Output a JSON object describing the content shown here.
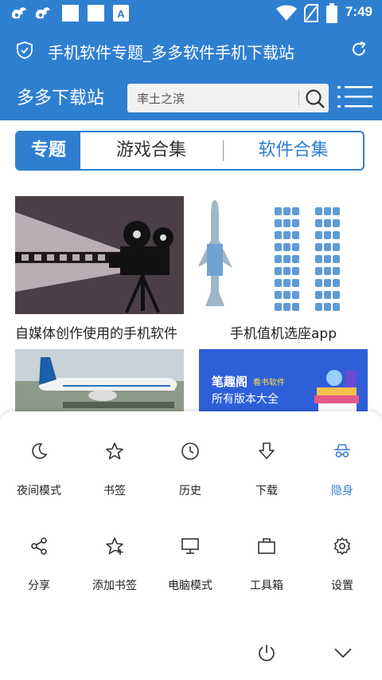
{
  "status_bar": {
    "time": "7:49",
    "icons": [
      "uc-browser-icon",
      "uc-browser-icon",
      "app-square-icon",
      "app-square-icon",
      "app-a-icon",
      "wifi-icon",
      "no-sim-icon",
      "battery-icon"
    ]
  },
  "title_bar": {
    "title": "手机软件专题_多多软件手机下载站",
    "left_icon": "shield-check-icon",
    "right_icon": "refresh-icon"
  },
  "site_header": {
    "logo": "多多下载站",
    "search_value": "率土之滨",
    "search_icon": "search-icon",
    "menu_icon": "menu-list-icon"
  },
  "tabs": [
    {
      "label": "专题",
      "active": true
    },
    {
      "label": "游戏合集",
      "active": false
    },
    {
      "label": "软件合集",
      "active": false
    }
  ],
  "cards": [
    {
      "title": "自媒体创作使用的手机软件"
    },
    {
      "title": "手机值机选座app"
    },
    {
      "title": "",
      "banner_text": ""
    },
    {
      "title": "",
      "banner_line1": "笔趣阁",
      "banner_tag": "看书软件",
      "banner_line2": "所有版本大全"
    }
  ],
  "menu": {
    "row1": [
      {
        "label": "夜间模式",
        "icon": "moon-icon",
        "active": false
      },
      {
        "label": "书签",
        "icon": "star-icon",
        "active": false
      },
      {
        "label": "历史",
        "icon": "clock-icon",
        "active": false
      },
      {
        "label": "下载",
        "icon": "download-arrow-icon",
        "active": false
      },
      {
        "label": "隐身",
        "icon": "incognito-icon",
        "active": true
      }
    ],
    "row2": [
      {
        "label": "分享",
        "icon": "share-icon",
        "active": false
      },
      {
        "label": "添加书签",
        "icon": "star-plus-icon",
        "active": false
      },
      {
        "label": "电脑模式",
        "icon": "monitor-icon",
        "active": false
      },
      {
        "label": "工具箱",
        "icon": "toolbox-icon",
        "active": false
      },
      {
        "label": "设置",
        "icon": "gear-icon",
        "active": false
      }
    ],
    "bottom": [
      {
        "icon": "power-icon"
      },
      {
        "icon": "chevron-down-icon"
      }
    ]
  },
  "colors": {
    "primary": "#2f7fd1",
    "active_menu": "#3a7bd5"
  }
}
